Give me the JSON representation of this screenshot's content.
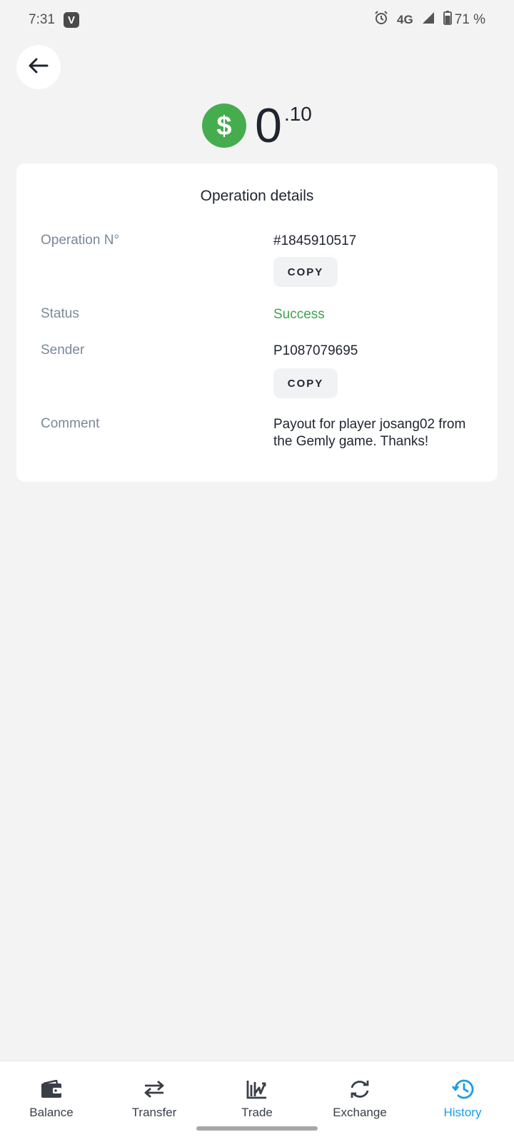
{
  "status_bar": {
    "time": "7:31",
    "app_badge": "V",
    "network": "4G",
    "battery": "71 %",
    "icons": [
      "alarm-icon",
      "signal-icon",
      "battery-icon"
    ]
  },
  "amount": {
    "integer": "0",
    "fraction": ".10",
    "currency_icon": "dollar-icon",
    "coin_color": "#46ad4f"
  },
  "details": {
    "title": "Operation details",
    "operation_label": "Operation N°",
    "operation_value": "#1845910517",
    "copy_label": "COPY",
    "status_label": "Status",
    "status_value": "Success",
    "status_color": "#3fa34d",
    "sender_label": "Sender",
    "sender_value": "P1087079695",
    "comment_label": "Comment",
    "comment_value": "Payout for player josang02 from the Gemly game. Thanks!"
  },
  "nav": {
    "active_color": "#1a9ee6",
    "items": [
      {
        "label": "Balance",
        "icon": "wallet-icon"
      },
      {
        "label": "Transfer",
        "icon": "transfer-icon"
      },
      {
        "label": "Trade",
        "icon": "trade-icon"
      },
      {
        "label": "Exchange",
        "icon": "exchange-icon"
      },
      {
        "label": "History",
        "icon": "history-icon",
        "active": true
      }
    ]
  }
}
